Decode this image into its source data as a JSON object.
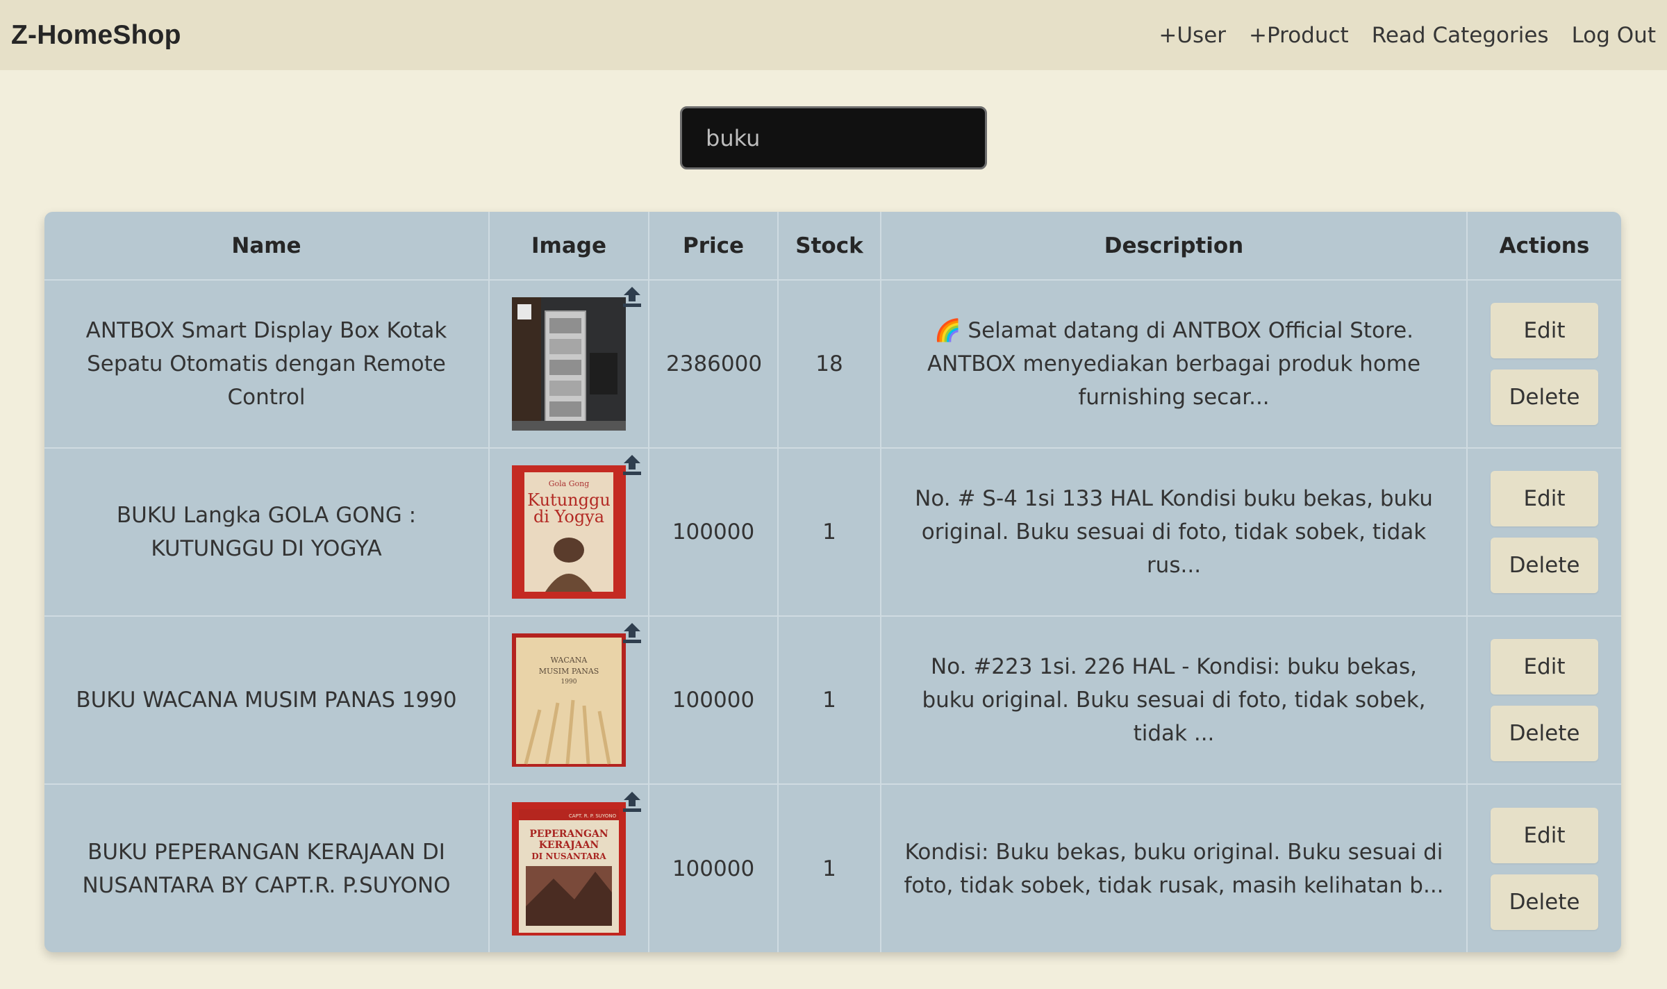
{
  "app": {
    "title": "Z-HomeShop"
  },
  "nav": {
    "items": [
      {
        "label": "+User"
      },
      {
        "label": "+Product"
      },
      {
        "label": "Read Categories"
      },
      {
        "label": "Log Out"
      }
    ]
  },
  "search": {
    "value": "buku"
  },
  "table": {
    "headers": {
      "name": "Name",
      "image": "Image",
      "price": "Price",
      "stock": "Stock",
      "description": "Description",
      "actions": "Actions"
    },
    "rows": [
      {
        "name": "ANTBOX Smart Display Box Kotak Sepatu Otomatis dengan Remote Control",
        "image_icon": "shoe-display-cabinet-photo",
        "price": "2386000",
        "stock": "18",
        "description": "🌈 Selamat datang di ANTBOX Official Store. ANTBOX menyediakan berbagai produk home furnishing secar...",
        "edit_label": "Edit",
        "delete_label": "Delete"
      },
      {
        "name": "BUKU Langka GOLA GONG : KUTUNGGU DI YOGYA",
        "image_icon": "book-cover-photo",
        "image_text": [
          "Gola Gong",
          "Kutunggu",
          "di Yogya"
        ],
        "price": "100000",
        "stock": "1",
        "description": "No. # S-4 1si 133 HAL Kondisi buku bekas, buku original. Buku sesuai di foto, tidak sobek, tidak rus...",
        "edit_label": "Edit",
        "delete_label": "Delete"
      },
      {
        "name": "BUKU WACANA MUSIM PANAS 1990",
        "image_icon": "book-cover-photo",
        "image_text": [
          "WACANA",
          "MUSIM PANAS",
          "1990"
        ],
        "price": "100000",
        "stock": "1",
        "description": "No. #223 1si. 226 HAL - Kondisi: buku bekas, buku original. Buku sesuai di foto, tidak sobek, tidak ...",
        "edit_label": "Edit",
        "delete_label": "Delete"
      },
      {
        "name": "BUKU PEPERANGAN KERAJAAN DI NUSANTARA BY CAPT.R. P.SUYONO",
        "image_icon": "book-cover-photo",
        "image_text": [
          "CAPT. R. P. SUYONO",
          "PEPERANGAN",
          "KERAJAAN",
          "DI NUSANTARA"
        ],
        "price": "100000",
        "stock": "1",
        "description": "Kondisi: Buku bekas, buku original. Buku sesuai di foto, tidak sobek, tidak rusak, masih kelihatan b...",
        "edit_label": "Edit",
        "delete_label": "Delete"
      }
    ]
  },
  "colors": {
    "page_bg": "#f2eedc",
    "navbar_bg": "#e6e0c8",
    "table_bg": "#b7c8d1",
    "button_bg": "#e6e0c8",
    "search_bg": "#111111"
  }
}
